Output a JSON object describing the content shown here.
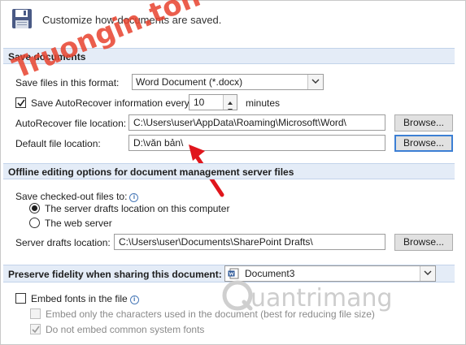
{
  "header": {
    "title": "Customize how documents are saved."
  },
  "save_documents": {
    "section_title": "Save documents",
    "format_label": "Save files in this format:",
    "format_value": "Word Document (*.docx)",
    "autorecover_label": "Save AutoRecover information every",
    "autorecover_checked": true,
    "autorecover_minutes": "10",
    "minutes_label": "minutes",
    "autorecover_location_label": "AutoRecover file location:",
    "autorecover_location_value": "C:\\Users\\user\\AppData\\Roaming\\Microsoft\\Word\\",
    "default_location_label": "Default file location:",
    "default_location_value": "D:\\văn bản\\",
    "browse_label": "Browse..."
  },
  "offline_editing": {
    "section_title": "Offline editing options for document management server files",
    "checked_out_label": "Save checked-out files to:",
    "option_server_drafts": "The server drafts location on this computer",
    "option_web_server": "The web server",
    "selected_option": "server_drafts",
    "server_drafts_label": "Server drafts location:",
    "server_drafts_value": "C:\\Users\\user\\Documents\\SharePoint Drafts\\",
    "browse_label": "Browse..."
  },
  "fidelity": {
    "section_title": "Preserve fidelity when sharing this document:",
    "document_value": "Document3",
    "embed_fonts_label": "Embed fonts in the file",
    "embed_fonts_checked": false,
    "embed_only_used_label": "Embed only the characters used in the document (best for reducing file size)",
    "embed_only_used_checked": false,
    "do_not_embed_common_label": "Do not embed common system fonts",
    "do_not_embed_common_checked": true
  },
  "watermarks": {
    "top": "Truongin.ton",
    "bottom": "uantrimang"
  },
  "colors": {
    "section_bar": "#e4ecf7",
    "accent_arrow": "#e0161c",
    "focus_border": "#3c7fd4"
  }
}
